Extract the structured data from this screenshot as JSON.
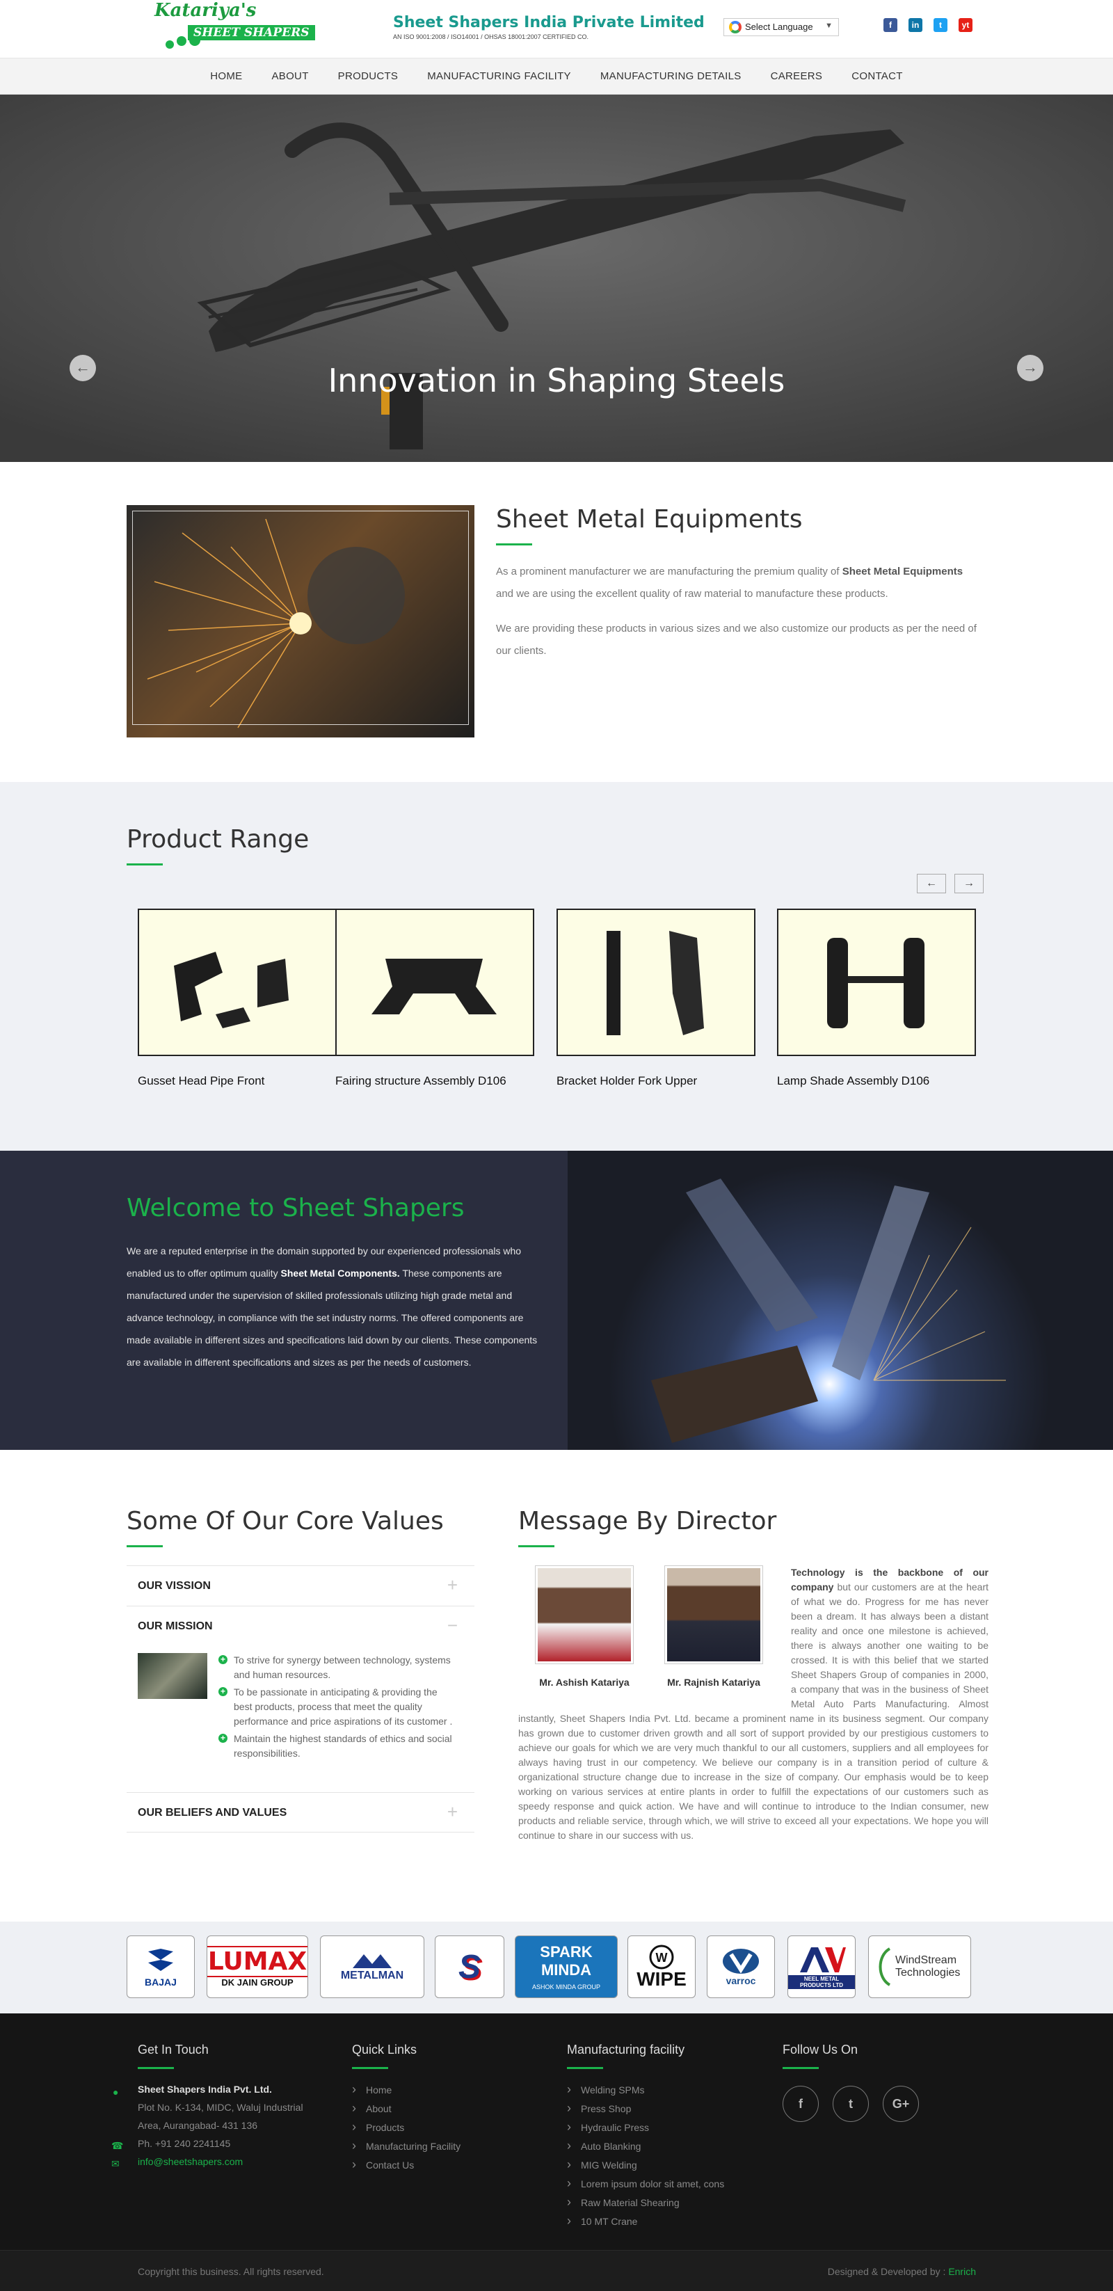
{
  "header": {
    "logo_script": "Katariya's",
    "logo_tag": "SHEET SHAPERS",
    "company_name": "Sheet Shapers India Private Limited",
    "certification": "AN ISO 9001:2008 / ISO14001 / OHSAS 18001:2007 CERTIFIED CO.",
    "language_label": "Select Language",
    "socials": [
      "f",
      "in",
      "t",
      "yt"
    ]
  },
  "nav": [
    "HOME",
    "ABOUT",
    "PRODUCTS",
    "MANUFACTURING FACILITY",
    "MANUFACTURING DETAILS",
    "CAREERS",
    "CONTACT"
  ],
  "hero": {
    "title": "Innovation in Shaping Steels",
    "prev": "←",
    "next": "→"
  },
  "equipments": {
    "title": "Sheet Metal Equipments",
    "p1_before": "As a prominent manufacturer we are manufacturing the premium quality of ",
    "p1_bold": "Sheet Metal Equipments",
    "p1_after": " and we are using the excellent quality of raw material to manufacture these products.",
    "p2": "We are providing these products in various sizes and we also customize our products as per the need of our clients."
  },
  "product_range": {
    "title": "Product Range",
    "prev": "←",
    "next": "→",
    "items": [
      {
        "name": "Gusset Head Pipe Front"
      },
      {
        "name": "Fairing structure Assembly D106"
      },
      {
        "name": "Bracket Holder Fork Upper"
      },
      {
        "name": "Lamp Shade Assembly D106"
      }
    ]
  },
  "welcome": {
    "title": "Welcome to Sheet Shapers",
    "text_before": "We are a reputed enterprise in the domain supported by our experienced professionals who enabled us to offer optimum quality ",
    "text_bold": "Sheet Metal Components.",
    "text_after": " These components are manufactured under the supervision of skilled professionals utilizing high grade metal and advance technology, in compliance with the set industry norms. The offered components are made available in different sizes and specifications laid down by our clients. These components are available in different specifications and sizes as per the needs of customers."
  },
  "core_values": {
    "title": "Some Of Our Core Values",
    "items": [
      {
        "title": "OUR VISSION",
        "toggle": "+"
      },
      {
        "title": "OUR MISSION",
        "toggle": "−"
      },
      {
        "title": "OUR BELIEFS AND VALUES",
        "toggle": "+"
      }
    ],
    "mission_points": [
      "To strive for synergy between technology, systems and human resources.",
      "To be passionate in anticipating & providing the best products, process that meet the quality performance and price aspirations of its customer .",
      "Maintain the highest standards of ethics and social responsibilities."
    ]
  },
  "director": {
    "title": "Message By Director",
    "people": [
      {
        "name": "Mr. Ashish Katariya"
      },
      {
        "name": "Mr. Rajnish Katariya"
      }
    ],
    "lead_bold": "Technology is the backbone of our company",
    "message": " but our customers are at the heart of what we do. Progress for me has never been a dream. It has always been a distant reality and once one milestone is achieved, there is always another one waiting to be crossed. It is with this belief that we started Sheet Shapers Group of companies in 2000, a company that was in the business of Sheet Metal Auto Parts Manufacturing. Almost instantly, Sheet Shapers India Pvt. Ltd. became a prominent name in its business segment. Our company has grown due to customer driven growth and all sort of support provided by our prestigious customers to achieve our goals for which we are very much thankful to our all customers, suppliers and all employees for always having trust in our competency. We believe our company is in a transition period of culture & organizational structure change due to increase in the size of company. Our emphasis would be to keep working on various services at entire plants in order to fulfill the expectations of our customers such as speedy response and quick action. We have and will continue to introduce to the Indian consumer, new products and reliable service, through which, we will strive to exceed all your expectations. We hope you will continue to share in our success with us."
  },
  "clients": [
    {
      "name": "BAJAJ"
    },
    {
      "name": "LUMAX",
      "sub": "DK JAIN GROUP"
    },
    {
      "name": "METALMAN"
    },
    {
      "name": "S"
    },
    {
      "name": "SPARK MINDA",
      "sub": "ASHOK MINDA GROUP"
    },
    {
      "name": "WIPE"
    },
    {
      "name": "varroc"
    },
    {
      "name": "NEEL METAL PRODUCTS LTD"
    },
    {
      "name": "WindStream Technologies"
    }
  ],
  "footer": {
    "get_in_touch": {
      "title": "Get In Touch",
      "company": "Sheet Shapers India Pvt. Ltd.",
      "address1": "Plot No. K-134, MIDC, Waluj Industrial",
      "address2": "Area, Aurangabad- 431 136",
      "phone": "Ph. +91 240 2241145",
      "email": "info@sheetshapers.com"
    },
    "quick_links": {
      "title": "Quick Links",
      "links": [
        "Home",
        "About",
        "Products",
        "Manufacturing Facility",
        "Contact Us"
      ]
    },
    "facility": {
      "title": "Manufacturing facility",
      "links": [
        "Welding SPMs",
        "Press Shop",
        "Hydraulic Press",
        "Auto Blanking",
        "MIG Welding",
        "Lorem ipsum dolor sit amet, cons",
        "Raw Material Shearing",
        "10 MT Crane"
      ]
    },
    "follow": {
      "title": "Follow Us On",
      "icons": [
        "f",
        "t",
        "G+"
      ]
    },
    "copyright": "Copyright this business. All rights reserved.",
    "designed_by": "Designed & Developed by : ",
    "designer": "Enrich"
  }
}
